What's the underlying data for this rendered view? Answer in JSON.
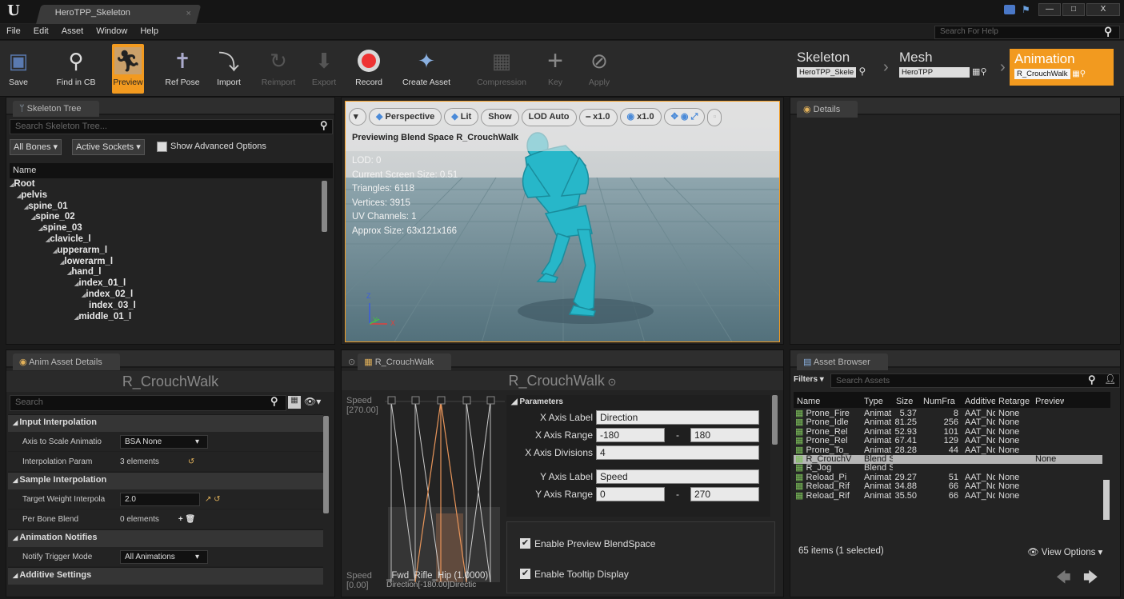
{
  "window": {
    "tab_title": "HeroTPP_Skeleton",
    "buttons": [
      "—",
      "□",
      "X"
    ]
  },
  "menu": {
    "items": [
      "File",
      "Edit",
      "Asset",
      "Window",
      "Help"
    ],
    "search_placeholder": "Search For Help"
  },
  "toolbar": {
    "items": [
      {
        "label": "Save",
        "icon": "floppy-icon",
        "state": "normal"
      },
      {
        "label": "Find in CB",
        "icon": "magnifier-icon",
        "state": "normal"
      },
      {
        "label": "Preview",
        "icon": "running-man-icon",
        "state": "active"
      },
      {
        "label": "Ref Pose",
        "icon": "t-pose-icon",
        "state": "normal"
      },
      {
        "label": "Import",
        "icon": "import-icon",
        "state": "normal"
      },
      {
        "label": "Reimport",
        "icon": "reimport-icon",
        "state": "disabled"
      },
      {
        "label": "Export",
        "icon": "export-icon",
        "state": "disabled"
      },
      {
        "label": "Record",
        "icon": "record-icon",
        "state": "normal"
      },
      {
        "label": "Create Asset",
        "icon": "create-asset-icon",
        "state": "normal"
      },
      {
        "label": "Compression",
        "icon": "compression-icon",
        "state": "disabled"
      },
      {
        "label": "Key",
        "icon": "plus-icon",
        "state": "disabled"
      },
      {
        "label": "Apply",
        "icon": "check-icon",
        "state": "disabled"
      }
    ]
  },
  "modes": {
    "skeleton": {
      "title": "Skeleton",
      "asset": "HeroTPP_Skele"
    },
    "mesh": {
      "title": "Mesh",
      "asset": "HeroTPP"
    },
    "animation": {
      "title": "Animation",
      "asset": "R_CrouchWalk"
    }
  },
  "skeleton_tree": {
    "tab": "Skeleton Tree",
    "search_placeholder": "Search Skeleton Tree...",
    "filter_bones": "All Bones",
    "filter_sockets": "Active Sockets",
    "show_advanced": "Show Advanced Options",
    "column": "Name",
    "bones": [
      {
        "prefix": "◢",
        "name": "Root",
        "depth": 0
      },
      {
        "prefix": "◢",
        "name": "pelvis",
        "depth": 1
      },
      {
        "prefix": "◢",
        "name": "spine_01",
        "depth": 2
      },
      {
        "prefix": "◢",
        "name": "spine_02",
        "depth": 3
      },
      {
        "prefix": "◢",
        "name": "spine_03",
        "depth": 4
      },
      {
        "prefix": "◢",
        "name": "clavicle_l",
        "depth": 5
      },
      {
        "prefix": "◢",
        "name": "upperarm_l",
        "depth": 6
      },
      {
        "prefix": "◢",
        "name": "lowerarm_l",
        "depth": 7
      },
      {
        "prefix": "◢",
        "name": "hand_l",
        "depth": 8
      },
      {
        "prefix": "◢",
        "name": "index_01_l",
        "depth": 9
      },
      {
        "prefix": "◢",
        "name": "index_02_l",
        "depth": 10
      },
      {
        "prefix": "",
        "name": "index_03_l",
        "depth": 11
      },
      {
        "prefix": "◢",
        "name": "middle_01_l",
        "depth": 9
      }
    ]
  },
  "viewport": {
    "buttons": [
      "Perspective",
      "Lit",
      "Show",
      "LOD Auto",
      "x1.0",
      "x1.0"
    ],
    "preview_title": "Previewing Blend Space R_CrouchWalk",
    "stats": [
      "LOD: 0",
      "Current Screen Size: 0.51",
      "Triangles: 6118",
      "Vertices: 3915",
      "UV Channels: 1",
      "Approx Size: 63x121x166"
    ],
    "axes": {
      "z": "Z",
      "y": "Y",
      "x": "X"
    }
  },
  "details": {
    "tab": "Details"
  },
  "anim_asset_details": {
    "tab": "Anim Asset Details",
    "title": "R_CrouchWalk",
    "search_placeholder": "Search",
    "sections": [
      {
        "title": "Input Interpolation",
        "props": [
          {
            "name": "Axis to Scale Animatio",
            "value": "BSA None",
            "type": "combo"
          },
          {
            "name": "Interpolation Param",
            "value": "3 elements",
            "type": "text"
          }
        ]
      },
      {
        "title": "Sample Interpolation",
        "props": [
          {
            "name": "Target Weight Interpola",
            "value": "2.0",
            "type": "num"
          },
          {
            "name": "Per Bone Blend",
            "value": "0 elements",
            "type": "text"
          }
        ]
      },
      {
        "title": "Animation Notifies",
        "props": [
          {
            "name": "Notify Trigger Mode",
            "value": "All Animations",
            "type": "combo"
          }
        ]
      },
      {
        "title": "Additive Settings",
        "props": []
      }
    ]
  },
  "blendspace": {
    "tab": "R_CrouchWalk",
    "title": "R_CrouchWalk",
    "speed_top_label": "Speed",
    "speed_top_value": "[270.00]",
    "speed_bottom_label": "Speed",
    "speed_bottom_value": "[0.00]",
    "bottom_sample": "_Fwd_Rifle_Hip (1.0000)",
    "bottom_direction": "Direction[-180.00]Directic",
    "parameters_header": "Parameters",
    "x_axis_label": "Direction",
    "x_axis_range_min": "-180",
    "x_axis_range_max": "180",
    "x_axis_divisions": "4",
    "y_axis_label": "Speed",
    "y_axis_range_min": "0",
    "y_axis_range_max": "270",
    "labels": {
      "x_label": "X Axis Label",
      "x_range": "X Axis Range",
      "x_div": "X Axis Divisions",
      "y_label": "Y Axis Label",
      "y_range": "Y Axis Range",
      "dash": "-"
    },
    "enable_preview": "Enable Preview BlendSpace",
    "enable_tooltip": "Enable Tooltip Display"
  },
  "asset_browser": {
    "tab": "Asset Browser",
    "filters": "Filters",
    "search_placeholder": "Search Assets",
    "columns": [
      "Name",
      "Type",
      "Size",
      "NumFra",
      "Additive",
      "Retarge",
      "Preview"
    ],
    "rows": [
      [
        "Prone_Fire",
        "Animat",
        "5.37",
        "8",
        "AAT_No",
        "None",
        ""
      ],
      [
        "Prone_Idle",
        "Animat",
        "81.25",
        "256",
        "AAT_No",
        "None",
        ""
      ],
      [
        "Prone_Rel",
        "Animat",
        "52.93",
        "101",
        "AAT_No",
        "None",
        ""
      ],
      [
        "Prone_Rel",
        "Animat",
        "67.41",
        "129",
        "AAT_No",
        "None",
        ""
      ],
      [
        "Prone_To_",
        "Animat",
        "28.28",
        "44",
        "AAT_No",
        "None",
        ""
      ],
      [
        "R_CrouchV",
        "Blend S",
        "",
        "",
        "",
        "",
        "None"
      ],
      [
        "R_Jog",
        "Blend S",
        "",
        "",
        "",
        "",
        ""
      ],
      [
        "Reload_Pi",
        "Animat",
        "29.27",
        "51",
        "AAT_No",
        "None",
        ""
      ],
      [
        "Reload_Rif",
        "Animat",
        "34.88",
        "66",
        "AAT_No",
        "None",
        ""
      ],
      [
        "Reload_Rif",
        "Animat",
        "35.50",
        "66",
        "AAT_No",
        "None",
        ""
      ]
    ],
    "selected_index": 5,
    "count": "65 items (1 selected)",
    "view_options": "View Options"
  },
  "colors": {
    "accent": "#f29a1f",
    "mannequin": "#27b7c9",
    "selected_row": "#b5b5b5"
  }
}
